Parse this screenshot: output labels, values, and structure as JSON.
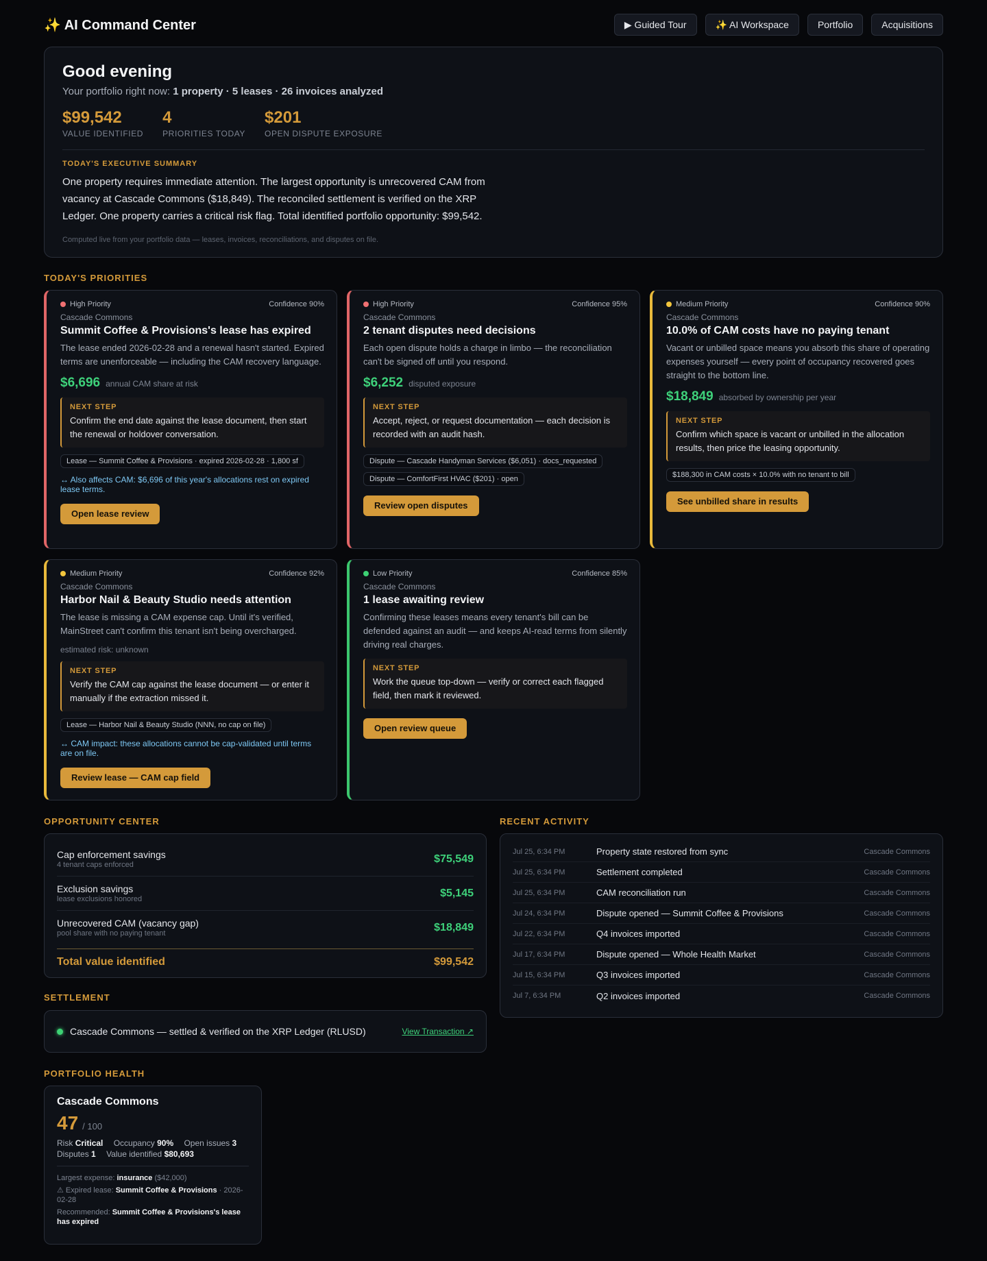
{
  "header": {
    "title": "✨ AI Command Center",
    "nav": [
      "▶ Guided Tour",
      "✨ AI Workspace",
      "Portfolio",
      "Acquisitions"
    ]
  },
  "hero": {
    "greeting": "Good evening",
    "subline_prefix": "Your portfolio right now:",
    "subline_stats": "1 property · 5 leases · 26 invoices analyzed",
    "kpis": [
      {
        "value": "$99,542",
        "label": "VALUE IDENTIFIED"
      },
      {
        "value": "4",
        "label": "PRIORITIES TODAY"
      },
      {
        "value": "$201",
        "label": "OPEN DISPUTE EXPOSURE"
      }
    ],
    "summary_kicker": "TODAY'S EXECUTIVE SUMMARY",
    "summary": "One property requires immediate attention. The largest opportunity is unrecovered CAM from vacancy at Cascade Commons ($18,849). The reconciled settlement is verified on the XRP Ledger. One property carries a critical risk flag. Total identified portfolio opportunity: $99,542.",
    "footnote": "Computed live from your portfolio data — leases, invoices, reconciliations, and disputes on file."
  },
  "priorities": {
    "title": "TODAY'S PRIORITIES",
    "next_step_label": "NEXT STEP",
    "cards": [
      {
        "priority": "High Priority",
        "confidence": "Confidence 90%",
        "property": "Cascade Commons",
        "title": "Summit Coffee & Provisions's lease has expired",
        "desc": "The lease ended 2026-02-28 and a renewal hasn't started. Expired terms are unenforceable — including the CAM recovery language.",
        "impact_value": "$6,696",
        "impact_label": "annual CAM share at risk",
        "next_step": "Confirm the end date against the lease document, then start the renewal or holdover conversation.",
        "chips": [
          "Lease — Summit Coffee & Provisions · expired 2026-02-28 · 1,800 sf"
        ],
        "cross": "↔ Also affects CAM: $6,696 of this year's allocations rest on expired lease terms.",
        "cta": "Open lease review"
      },
      {
        "priority": "High Priority",
        "confidence": "Confidence 95%",
        "property": "Cascade Commons",
        "title": "2 tenant disputes need decisions",
        "desc": "Each open dispute holds a charge in limbo — the reconciliation can't be signed off until you respond.",
        "impact_value": "$6,252",
        "impact_label": "disputed exposure",
        "next_step": "Accept, reject, or request documentation — each decision is recorded with an audit hash.",
        "chips": [
          "Dispute — Cascade Handyman Services ($6,051) · docs_requested",
          "Dispute — ComfortFirst HVAC ($201) · open"
        ],
        "cta": "Review open disputes"
      },
      {
        "priority": "Medium Priority",
        "confidence": "Confidence 90%",
        "property": "Cascade Commons",
        "title": "10.0% of CAM costs have no paying tenant",
        "desc": "Vacant or unbilled space means you absorb this share of operating expenses yourself — every point of occupancy recovered goes straight to the bottom line.",
        "impact_value": "$18,849",
        "impact_label": "absorbed by ownership per year",
        "next_step": "Confirm which space is vacant or unbilled in the allocation results, then price the leasing opportunity.",
        "chips": [
          "$188,300 in CAM costs × 10.0% with no tenant to bill"
        ],
        "cta": "See unbilled share in results"
      },
      {
        "priority": "Medium Priority",
        "confidence": "Confidence 92%",
        "property": "Cascade Commons",
        "title": "Harbor Nail & Beauty Studio needs attention",
        "desc": "The lease is missing a CAM expense cap. Until it's verified, MainStreet can't confirm this tenant isn't being overcharged.",
        "risk_note": "estimated risk: unknown",
        "next_step": "Verify the CAM cap against the lease document — or enter it manually if the extraction missed it.",
        "chips": [
          "Lease — Harbor Nail & Beauty Studio (NNN, no cap on file)"
        ],
        "cross": "↔ CAM impact: these allocations cannot be cap-validated until terms are on file.",
        "cta": "Review lease — CAM cap field"
      },
      {
        "priority": "Low Priority",
        "confidence": "Confidence 85%",
        "property": "Cascade Commons",
        "title": "1 lease awaiting review",
        "desc": "Confirming these leases means every tenant's bill can be defended against an audit — and keeps AI-read terms from silently driving real charges.",
        "next_step": "Work the queue top-down — verify or correct each flagged field, then mark it reviewed.",
        "cta": "Open review queue"
      }
    ]
  },
  "opportunity": {
    "title": "OPPORTUNITY CENTER",
    "rows": [
      {
        "name": "Cap enforcement savings",
        "sub": "4 tenant caps enforced",
        "value": "$75,549"
      },
      {
        "name": "Exclusion savings",
        "sub": "lease exclusions honored",
        "value": "$5,145"
      },
      {
        "name": "Unrecovered CAM (vacancy gap)",
        "sub": "pool share with no paying tenant",
        "value": "$18,849"
      }
    ],
    "total_label": "Total value identified",
    "total_value": "$99,542"
  },
  "activity": {
    "title": "RECENT ACTIVITY",
    "rows": [
      {
        "time": "Jul 25, 6:34 PM",
        "text": "Property state restored from sync",
        "prop": "Cascade Commons"
      },
      {
        "time": "Jul 25, 6:34 PM",
        "text": "Settlement completed",
        "prop": "Cascade Commons"
      },
      {
        "time": "Jul 25, 6:34 PM",
        "text": "CAM reconciliation run",
        "prop": "Cascade Commons"
      },
      {
        "time": "Jul 24, 6:34 PM",
        "text": "Dispute opened — Summit Coffee & Provisions",
        "prop": "Cascade Commons"
      },
      {
        "time": "Jul 22, 6:34 PM",
        "text": "Q4 invoices imported",
        "prop": "Cascade Commons"
      },
      {
        "time": "Jul 17, 6:34 PM",
        "text": "Dispute opened — Whole Health Market",
        "prop": "Cascade Commons"
      },
      {
        "time": "Jul 15, 6:34 PM",
        "text": "Q3 invoices imported",
        "prop": "Cascade Commons"
      },
      {
        "time": "Jul 7, 6:34 PM",
        "text": "Q2 invoices imported",
        "prop": "Cascade Commons"
      }
    ]
  },
  "settlement": {
    "title": "SETTLEMENT",
    "text": "Cascade Commons — settled & verified on the XRP Ledger (RLUSD)",
    "link": "View Transaction ↗"
  },
  "health": {
    "title": "PORTFOLIO HEALTH",
    "property": "Cascade Commons",
    "score": "47",
    "score_suffix": "/ 100",
    "risk_label": "Risk",
    "risk": "Critical",
    "occupancy_label": "Occupancy",
    "occupancy": "90%",
    "issues_label": "Open issues",
    "issues": "3",
    "disputes_label": "Disputes",
    "disputes": "1",
    "value_label": "Value identified",
    "value": "$80,693",
    "largest_label": "Largest expense:",
    "largest": "insurance",
    "largest_amt": "($42,000)",
    "expired_label": "⚠ Expired lease:",
    "expired": "Summit Coffee & Provisions",
    "expired_date": "· 2026-02-28",
    "recommended_label": "Recommended:",
    "recommended": "Summit Coffee & Provisions's lease has expired"
  },
  "colors": {
    "accent": "#d49a3a",
    "positive": "#3ed17a",
    "high": "#f07072",
    "medium": "#f2c53d",
    "low": "#3dd174",
    "background": "#07080b"
  }
}
